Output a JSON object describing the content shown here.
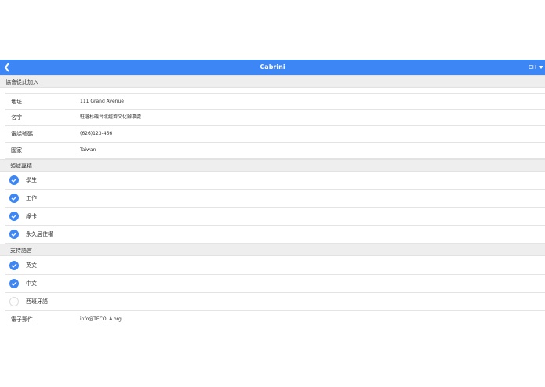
{
  "header": {
    "title": "Cabrini",
    "language": "CH",
    "accent": "#3d86f5"
  },
  "page_title": "協會從此加入",
  "fields": [
    {
      "label": "地址",
      "value": "111 Grand Avenue"
    },
    {
      "label": "名字",
      "value": "駐洛杉磯台北經濟文化辦事處"
    },
    {
      "label": "電話號碼",
      "value": "(626)123-456"
    },
    {
      "label": "國家",
      "value": "Taiwan"
    }
  ],
  "specialties": {
    "title": "領域專精",
    "items": [
      {
        "label": "學生",
        "checked": true
      },
      {
        "label": "工作",
        "checked": true
      },
      {
        "label": "綠卡",
        "checked": true
      },
      {
        "label": "永久居住權",
        "checked": true
      }
    ]
  },
  "languages": {
    "title": "支持語言",
    "items": [
      {
        "label": "英文",
        "checked": true
      },
      {
        "label": "中文",
        "checked": true
      },
      {
        "label": "西班牙語",
        "checked": false
      }
    ]
  },
  "email": {
    "label": "電子郵件",
    "value": "info@TECOLA.org"
  },
  "icons": {
    "back": "chevron-left-icon",
    "language_dropdown": "caret-down-icon",
    "checked": "checkmark-icon"
  }
}
